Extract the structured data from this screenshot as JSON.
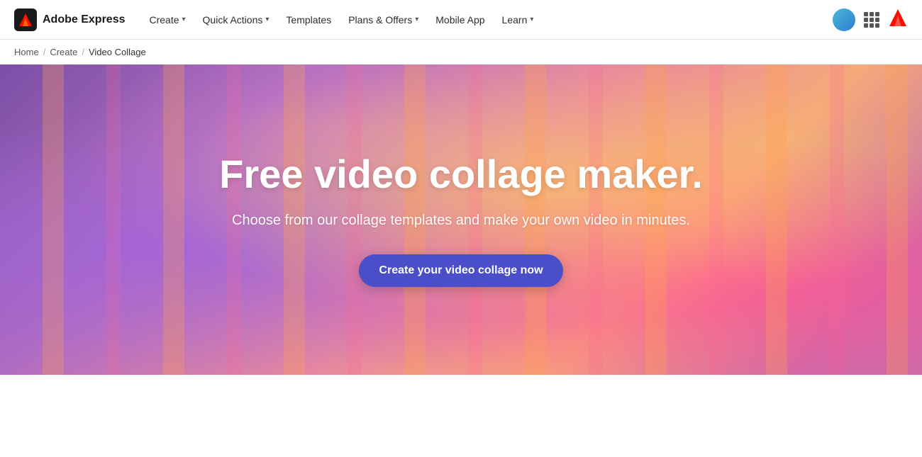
{
  "nav": {
    "logo_text": "Adobe Express",
    "links": [
      {
        "label": "Create",
        "has_dropdown": true
      },
      {
        "label": "Quick Actions",
        "has_dropdown": true
      },
      {
        "label": "Templates",
        "has_dropdown": false
      },
      {
        "label": "Plans & Offers",
        "has_dropdown": true
      },
      {
        "label": "Mobile App",
        "has_dropdown": false
      },
      {
        "label": "Learn",
        "has_dropdown": true
      }
    ]
  },
  "breadcrumb": {
    "home": "Home",
    "sep1": "/",
    "create": "Create",
    "sep2": "/",
    "current": "Video Collage"
  },
  "hero": {
    "title": "Free video collage maker.",
    "subtitle": "Choose from our collage templates and make your own video in minutes.",
    "cta_label": "Create your video collage now"
  }
}
